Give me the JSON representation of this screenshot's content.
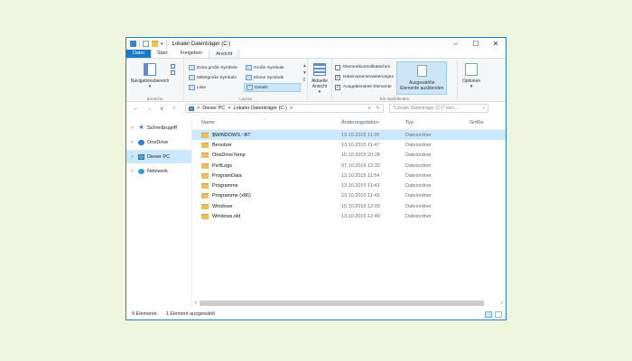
{
  "window": {
    "title": "Lokaler Datenträger (C:)",
    "accent": "#1979ca",
    "controls": {
      "minimize": "–",
      "maximize": "☐",
      "close": "✕"
    }
  },
  "qat": {
    "caret": "▾"
  },
  "ribbon": {
    "tabs": [
      "Datei",
      "Start",
      "Freigeben",
      "Ansicht"
    ],
    "active_tab": "Ansicht",
    "groups": {
      "panes": {
        "label": "Bereiche",
        "nav_pane_button": "Navigationsbereich",
        "caret": "▾"
      },
      "layout": {
        "label": "Layout",
        "options": [
          "Extra große Symbole",
          "Große Symbole",
          "Mittelgroße Symbole",
          "Kleine Symbole",
          "Liste",
          "Details"
        ],
        "selected": "Details",
        "scroll_up": "▲",
        "scroll_down": "▼",
        "more": "⊽"
      },
      "current_view": {
        "label": "Aktuelle Ansicht",
        "line1": "Aktuelle",
        "line2": "Ansicht ▾"
      },
      "show_hide": {
        "label": "Ein-/ausblenden",
        "checkboxes": [
          {
            "label": "Elementkontrollkästchen",
            "mark": ""
          },
          {
            "label": "Dateinamenerweiterungen",
            "mark": "✓"
          },
          {
            "label": "Ausgeblendete Elemente",
            "mark": "✓"
          }
        ],
        "hide_button_line1": "Ausgewählte",
        "hide_button_line2": "Elemente ausblenden"
      },
      "options": {
        "label": "Optionen",
        "caret": "▾"
      }
    }
  },
  "address": {
    "back": "←",
    "forward": "→",
    "recent": "∨",
    "up": "↑",
    "path": [
      "Dieser PC",
      "Lokaler Datenträger (C:)"
    ],
    "separator": ">",
    "dropdown": "∨",
    "refresh": "↻",
    "search_placeholder": "\"Lokaler Datenträger (C:)\" durc...",
    "search_icon": "⌕"
  },
  "nav": {
    "arrow": ">",
    "items": [
      {
        "label": "Schnellzugriff",
        "icon": "star-icon"
      },
      {
        "label": "OneDrive",
        "icon": "cloud-icon"
      },
      {
        "label": "Dieser PC",
        "icon": "computer-icon",
        "selected": true
      },
      {
        "label": "Netzwerk",
        "icon": "network-icon"
      }
    ]
  },
  "files": {
    "columns": [
      "Name",
      "Änderungsdatum",
      "Typ",
      "Größe"
    ],
    "sort_caret": "^",
    "rows": [
      {
        "name": "$WINDOWS.~BT",
        "date": "13.10.2015 11:35",
        "type": "Dateiordner",
        "selected": true
      },
      {
        "name": "Benutzer",
        "date": "13.10.2015 11:47",
        "type": "Dateiordner"
      },
      {
        "name": "OneDriveTemp",
        "date": "15.10.2015 20:28",
        "type": "Dateiordner"
      },
      {
        "name": "PerfLogs",
        "date": "07.10.2015 12:32",
        "type": "Dateiordner"
      },
      {
        "name": "ProgramData",
        "date": "13.10.2015 11:54",
        "type": "Dateiordner"
      },
      {
        "name": "Programme",
        "date": "13.10.2015 11:43",
        "type": "Dateiordner"
      },
      {
        "name": "Programme (x86)",
        "date": "13.10.2015 11:43",
        "type": "Dateiordner"
      },
      {
        "name": "Windows",
        "date": "15.10.2015 12:00",
        "type": "Dateiordner"
      },
      {
        "name": "Windows.old",
        "date": "13.10.2015 12:40",
        "type": "Dateiordner"
      }
    ],
    "scroll_left": "<",
    "scroll_right": ">"
  },
  "status": {
    "count": "9 Elemente",
    "selection": "1 Element ausgewählt"
  }
}
